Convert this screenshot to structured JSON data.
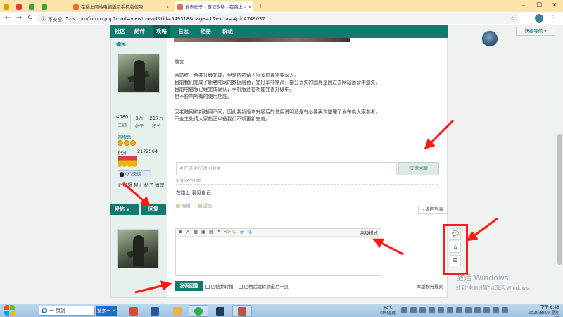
{
  "browser": {
    "tabs": [
      {
        "title": "",
        "pinned": true,
        "color": "#d9a400"
      },
      {
        "title": "",
        "pinned": true,
        "color": "#e53935"
      },
      {
        "title": "",
        "pinned": true,
        "color": "#3aa335"
      },
      {
        "title": "",
        "pinned": true,
        "color": "#3aa335"
      },
      {
        "title": "在路上网站电脑版及手机版使用",
        "pinned": false,
        "color": "#e0703a"
      },
      {
        "title": "发表帖子 - 游记攻略 - 在路上 - ",
        "pinned": false,
        "color": "#e0703a"
      }
    ],
    "tab_close": "×",
    "new_tab": "+",
    "win_controls": [
      "–",
      "☐",
      "✕"
    ],
    "nav": {
      "back": "←",
      "forward": "→",
      "reload": "↻"
    },
    "security_label": "不安全",
    "url": "5zls.com/forum.php?mod=viewthread&tid=549318&page=1&extra=#pid4749037",
    "star": "☆",
    "menu": "⋮"
  },
  "forum_nav": {
    "items": [
      "社区",
      "結伴",
      "攻略",
      "日志",
      "相册",
      "群组"
    ],
    "current_index": 2,
    "quick_nav": "快捷导航 ▾"
  },
  "post": {
    "author": "瀟民",
    "stats": [
      {
        "num": "4080",
        "label": "主题"
      },
      {
        "num": "3万",
        "label": "帖子"
      },
      {
        "num": "217万",
        "label": "积分"
      }
    ],
    "group": "管理员",
    "points_label": "积分",
    "points_value": "2172564",
    "qq_label": "QQ交谈",
    "admin_links": "IP  编辑  禁止  帖子  清理",
    "heading": "前言",
    "paragraph1": [
      "网站终于合并升级完成，但是依然留下很多位置需要深入。",
      "目前我们完成了新老陆网的数据融合，完好率非常高，部分丢失的图片是因过去网站运营中遗失。",
      "目前电脑版已经完成确认，手机版还在功能完善升级中。",
      "但不影响所有的使用功能。"
    ],
    "paragraph2": [
      "因老陆网和新陆网不同，因此我新版本升级后的使用说明还是有必要再次整理了发布供大家参考。",
      "不全之处请大家指正以备我们不断更新完善。"
    ],
    "reply_placeholder": "#在这里快速回复#",
    "quick_reply_button": "快速回复",
    "signature_label": "SIGNATURE",
    "signature": "在路上  看见自己...",
    "actions": [
      "编辑",
      "提出"
    ]
  },
  "toolbar": {
    "post_button": "发帖",
    "reply_button": "回复",
    "back_button": "‹ 返回列表"
  },
  "reply": {
    "editor_tools": [
      "B",
      "A",
      "▦",
      "▣",
      "▤",
      "❝",
      "<>",
      "☺",
      "@",
      "📎"
    ],
    "advanced_mode": "高级模式",
    "submit_button": "发表回复",
    "option_repost": "回帖并转播",
    "option_jump": "回帖后跳转到最后一页",
    "rules_link": "本版积分规则"
  },
  "side_tools": [
    "💬",
    "⌂",
    "☰"
  ],
  "watermark": {
    "line1": "激活 Windows",
    "line2": "转到\"电脑设置\"以激活 Windows。"
  },
  "taskbar": {
    "search_text": "一 页游",
    "search_button": "搜索一下",
    "apps": [
      {
        "name": "chrome-like",
        "color": "#d84b3b"
      },
      {
        "name": "word",
        "color": "#2b5797"
      },
      {
        "name": "explorer",
        "color": "#e6b450"
      },
      {
        "name": "chrome",
        "color": "#34a853"
      },
      {
        "name": "photoshop",
        "color": "#1e3c64"
      },
      {
        "name": "app",
        "color": "#c0504d"
      }
    ],
    "temp": "42℃",
    "temp_label": "CPU温度",
    "time": "下午 6:48",
    "date": "2020/8/19 星期四"
  },
  "colors": {
    "accent": "#107a6f",
    "annotation": "#ff1a1a"
  }
}
